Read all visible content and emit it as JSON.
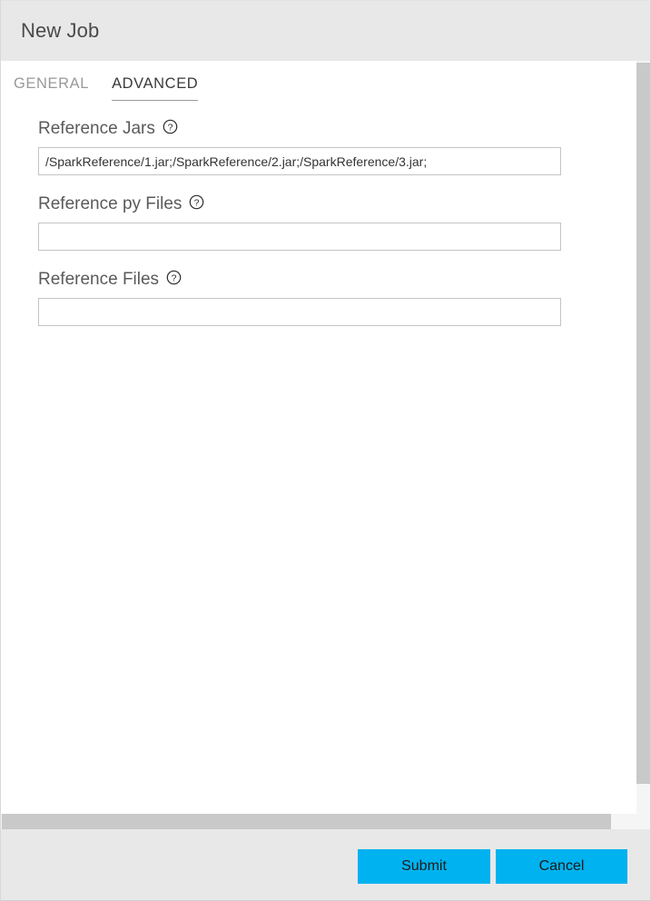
{
  "window": {
    "title": "New Job"
  },
  "tabs": [
    {
      "label": "GENERAL",
      "active": false
    },
    {
      "label": "ADVANCED",
      "active": true
    }
  ],
  "form": {
    "fields": [
      {
        "label": "Reference Jars",
        "help_icon": "question-circle-icon",
        "value": "/SparkReference/1.jar;/SparkReference/2.jar;/SparkReference/3.jar;",
        "placeholder": ""
      },
      {
        "label": "Reference py Files",
        "help_icon": "question-circle-icon",
        "value": "",
        "placeholder": ""
      },
      {
        "label": "Reference Files",
        "help_icon": "question-circle-icon",
        "value": "",
        "placeholder": ""
      }
    ]
  },
  "footer": {
    "submit_label": "Submit",
    "cancel_label": "Cancel"
  },
  "colors": {
    "accent": "#00b2f0",
    "titlebar_bg": "#e8e8e8",
    "footer_bg": "#e8e8e8",
    "scrollbar_thumb": "#c9c9c9",
    "tab_active_text": "#3a3a3a",
    "tab_inactive_text": "#999999"
  }
}
